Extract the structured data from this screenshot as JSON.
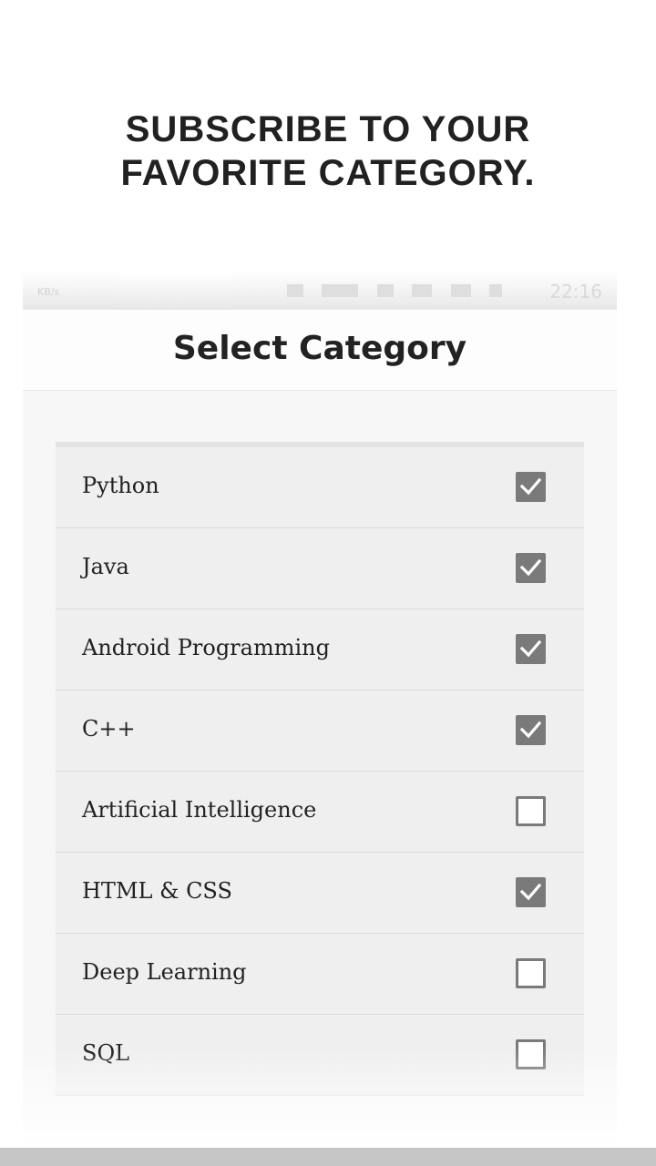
{
  "promo": {
    "line1": "SUBSCRIBE TO YOUR",
    "line2": "FAVORITE CATEGORY."
  },
  "status_bar": {
    "speed": "KB/s",
    "time": "22:16"
  },
  "app": {
    "title": "Select Category"
  },
  "categories": [
    {
      "label": "Python",
      "checked": true
    },
    {
      "label": "Java",
      "checked": true
    },
    {
      "label": "Android Programming",
      "checked": true
    },
    {
      "label": "C++",
      "checked": true
    },
    {
      "label": "Artificial Intelligence",
      "checked": false
    },
    {
      "label": "HTML & CSS",
      "checked": true
    },
    {
      "label": "Deep Learning",
      "checked": false
    },
    {
      "label": "SQL",
      "checked": false
    }
  ],
  "colors": {
    "checkbox": "#7a7a7a",
    "row_bg": "#efefef",
    "text": "#222222"
  }
}
